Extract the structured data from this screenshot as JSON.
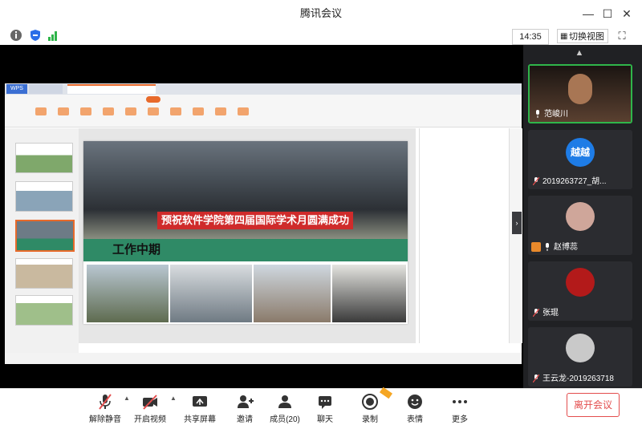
{
  "window": {
    "title": "腾讯会议"
  },
  "infobar": {
    "clock": "14:35",
    "switch_view": "切换视图"
  },
  "shared": {
    "banner": "预祝软件学院第四届国际学术月圆满成功",
    "section_title": "工作中期",
    "wps_tab": "WPS",
    "colors": {
      "banner": "#cf2b2b",
      "section": "#2f8a66"
    }
  },
  "participants": [
    {
      "name": "范峻川",
      "avatar_color": "#3a2a20"
    },
    {
      "name": "2019263727_胡...",
      "avatar_text": "越越",
      "avatar_color": "#1e7ce6"
    },
    {
      "name": "赵博蕊",
      "avatar_color": "#cfa69a"
    },
    {
      "name": "张琨",
      "avatar_color": "#b31a1a"
    },
    {
      "name": "王云龙-2019263718",
      "avatar_color": "#c9c9c9"
    }
  ],
  "toolbar": {
    "unmute": "解除静音",
    "video": "开启视频",
    "share": "共享屏幕",
    "invite": "邀请",
    "members": "成员(20)",
    "chat": "聊天",
    "record": "录制",
    "reactions": "表情",
    "more": "更多",
    "leave": "离开会议"
  }
}
